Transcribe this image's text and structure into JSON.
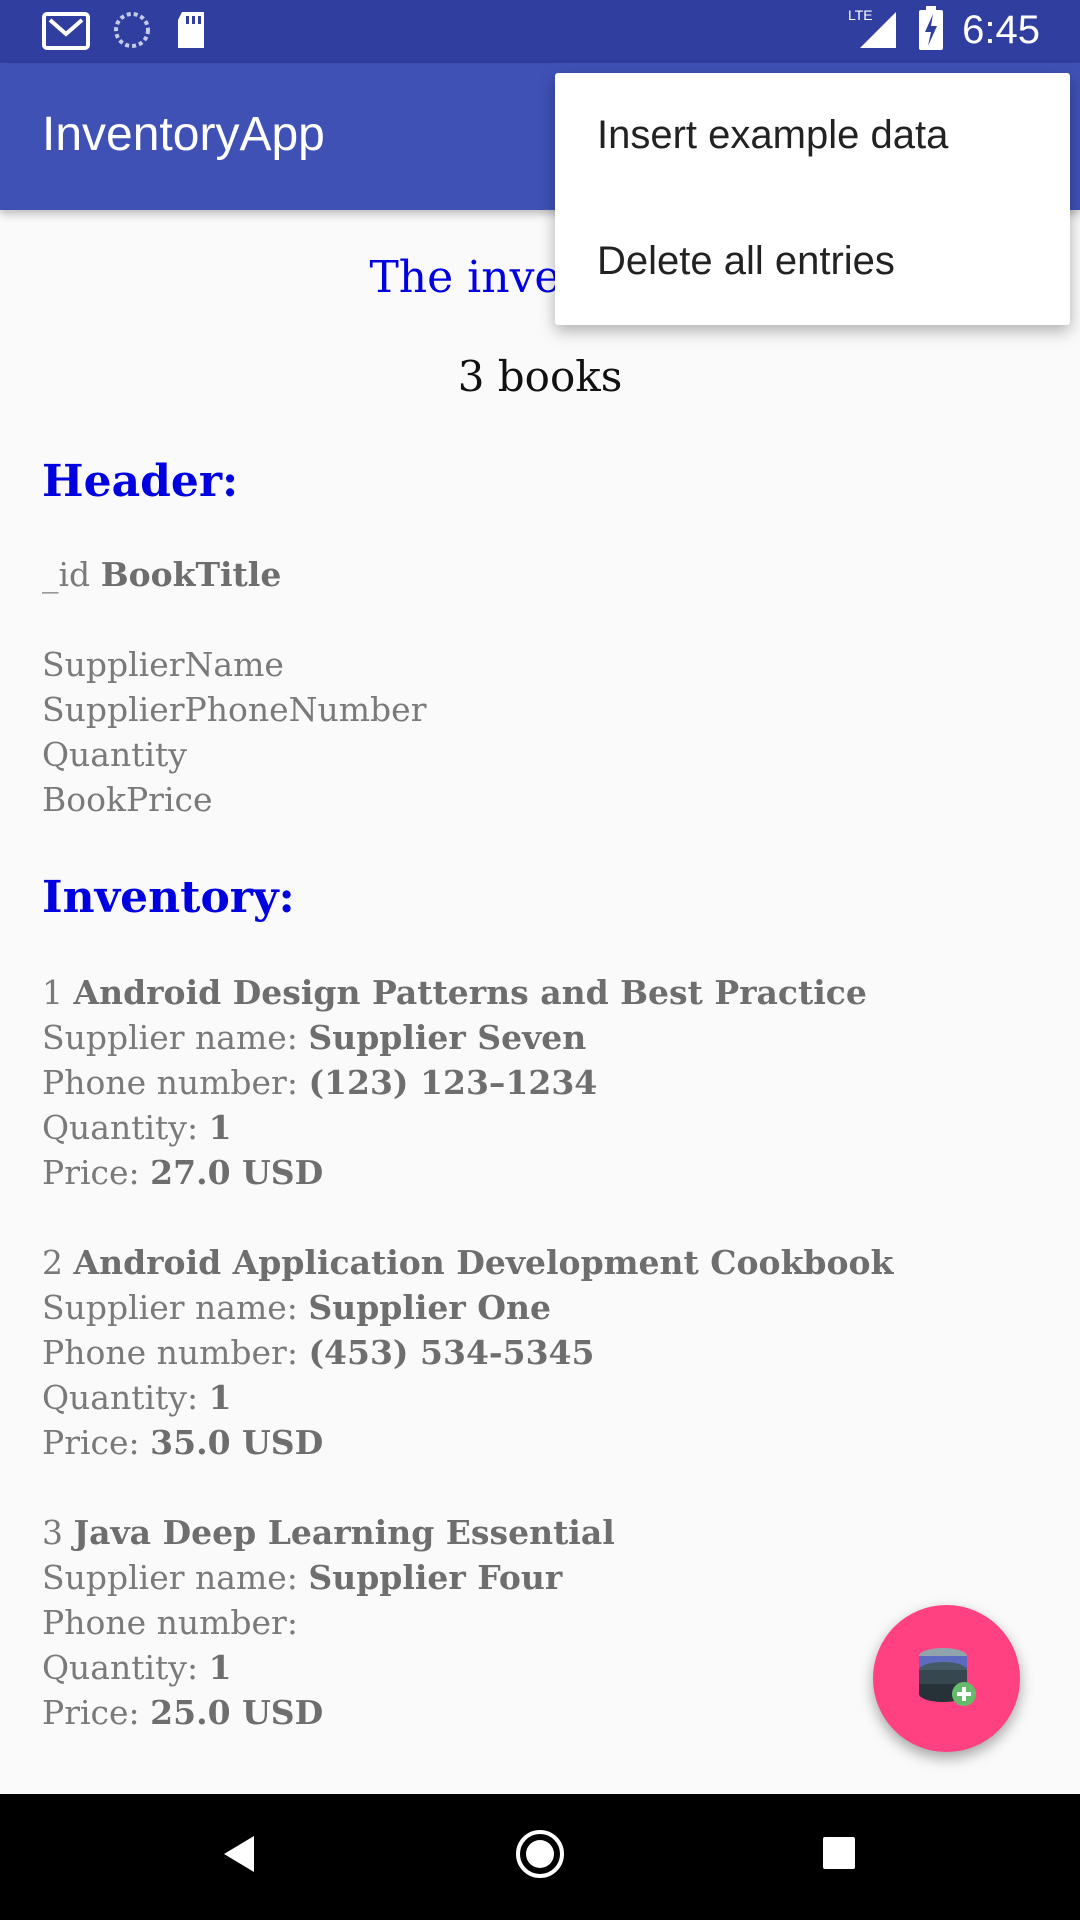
{
  "status_bar": {
    "time": "6:45",
    "network": "LTE",
    "icons": [
      "gmail-icon",
      "sync-icon",
      "sd-card-icon",
      "lte-signal-icon",
      "battery-charging-icon"
    ]
  },
  "app_bar": {
    "title": "InventoryApp"
  },
  "overflow_menu": {
    "items": [
      {
        "label": "Insert example data"
      },
      {
        "label": "Delete all entries"
      }
    ]
  },
  "main": {
    "table_title": "The inventory t",
    "book_count": "3 books",
    "header_section": {
      "heading": "Header:",
      "id_label": "_id",
      "title_label": "BookTitle",
      "fields": [
        "SupplierName",
        "SupplierPhoneNumber",
        "Quantity",
        "BookPrice"
      ]
    },
    "inventory_section": {
      "heading": "Inventory:",
      "supplier_label": "Supplier name: ",
      "phone_label": "Phone number: ",
      "quantity_label": "Quantity: ",
      "price_label": "Price: ",
      "items": [
        {
          "id": "1",
          "title": "Android Design Patterns and Best Practice",
          "supplier": "Supplier Seven",
          "phone": "(123) 123–1234",
          "quantity": "1",
          "price": "27.0 USD"
        },
        {
          "id": "2",
          "title": "Android Application Development Cookbook",
          "supplier": "Supplier One",
          "phone": "(453) 534-5345",
          "quantity": "1",
          "price": "35.0 USD"
        },
        {
          "id": "3",
          "title": "Java Deep Learning Essential",
          "supplier": "Supplier Four",
          "phone": "",
          "quantity": "1",
          "price": "25.0 USD"
        }
      ]
    }
  },
  "fab": {
    "icon": "database-add-icon",
    "color": "#ff4081"
  },
  "colors": {
    "primary": "#3f51b5",
    "primary_dark": "#303f9f",
    "accent": "#ff4081",
    "heading_blue": "#0000e0"
  }
}
